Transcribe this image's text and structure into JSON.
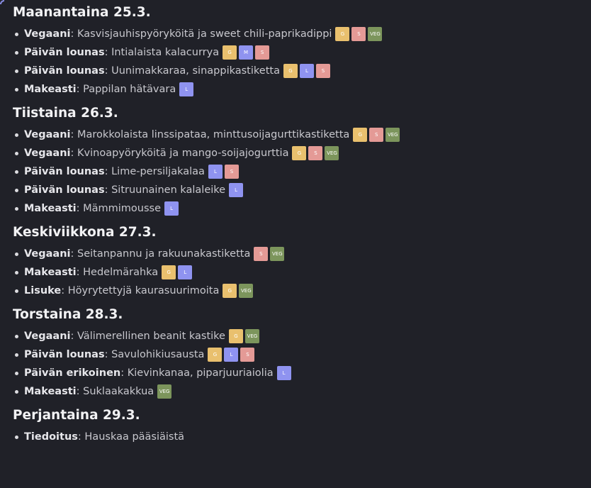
{
  "colors": {
    "background": "#202128",
    "tag_g": "#e9c06e",
    "tag_m": "#8f93f0",
    "tag_s": "#e49a96",
    "tag_l": "#8f93f0",
    "tag_veg": "#7c955c"
  },
  "days": [
    {
      "title": "Maanantaina 25.3.",
      "items": [
        {
          "category": "Vegaani",
          "dish": "Kasvisjauhispyöryköitä ja sweet chili-paprikadippi",
          "tags": [
            "G",
            "S",
            "VEG"
          ]
        },
        {
          "category": "Päivän lounas",
          "dish": "Intialaista kalacurrya",
          "tags": [
            "G",
            "M",
            "S"
          ]
        },
        {
          "category": "Päivän lounas",
          "dish": "Uunimakkaraa, sinappikastiketta",
          "tags": [
            "G",
            "L",
            "S"
          ]
        },
        {
          "category": "Makeasti",
          "dish": "Pappilan hätävara",
          "tags": [
            "L"
          ]
        }
      ]
    },
    {
      "title": "Tiistaina 26.3.",
      "items": [
        {
          "category": "Vegaani",
          "dish": "Marokkolaista linssipataa, minttusoijagurttikastiketta",
          "tags": [
            "G",
            "S",
            "VEG"
          ]
        },
        {
          "category": "Vegaani",
          "dish": "Kvinoapyöryköitä ja mango-soijajogurttia",
          "tags": [
            "G",
            "S",
            "VEG"
          ]
        },
        {
          "category": "Päivän lounas",
          "dish": "Lime-persiljakalaa",
          "tags": [
            "L",
            "S"
          ]
        },
        {
          "category": "Päivän lounas",
          "dish": "Sitruunainen kalaleike",
          "tags": [
            "L"
          ]
        },
        {
          "category": "Makeasti",
          "dish": "Mämmimousse",
          "tags": [
            "L"
          ]
        }
      ]
    },
    {
      "title": "Keskiviikkona 27.3.",
      "items": [
        {
          "category": "Vegaani",
          "dish": "Seitanpannu ja rakuunakastiketta",
          "tags": [
            "S",
            "VEG"
          ]
        },
        {
          "category": "Makeasti",
          "dish": "Hedelmärahka",
          "tags": [
            "G",
            "L"
          ]
        },
        {
          "category": "Lisuke",
          "dish": "Höyrytettyjä kaurasuurimoita",
          "tags": [
            "G",
            "VEG"
          ]
        }
      ]
    },
    {
      "title": "Torstaina 28.3.",
      "items": [
        {
          "category": "Vegaani",
          "dish": "Välimerellinen beanit kastike",
          "tags": [
            "G",
            "VEG"
          ]
        },
        {
          "category": "Päivän lounas",
          "dish": "Savulohikiusausta",
          "tags": [
            "G",
            "L",
            "S"
          ]
        },
        {
          "category": "Päivän erikoinen",
          "dish": "Kievinkanaa, piparjuuriaiolia",
          "tags": [
            "L"
          ]
        },
        {
          "category": "Makeasti",
          "dish": "Suklaakakkua",
          "tags": [
            "VEG"
          ]
        }
      ]
    },
    {
      "title": "Perjantaina 29.3.",
      "items": [
        {
          "category": "Tiedoitus",
          "dish": "Hauskaa pääsiäistä",
          "tags": []
        }
      ]
    }
  ]
}
